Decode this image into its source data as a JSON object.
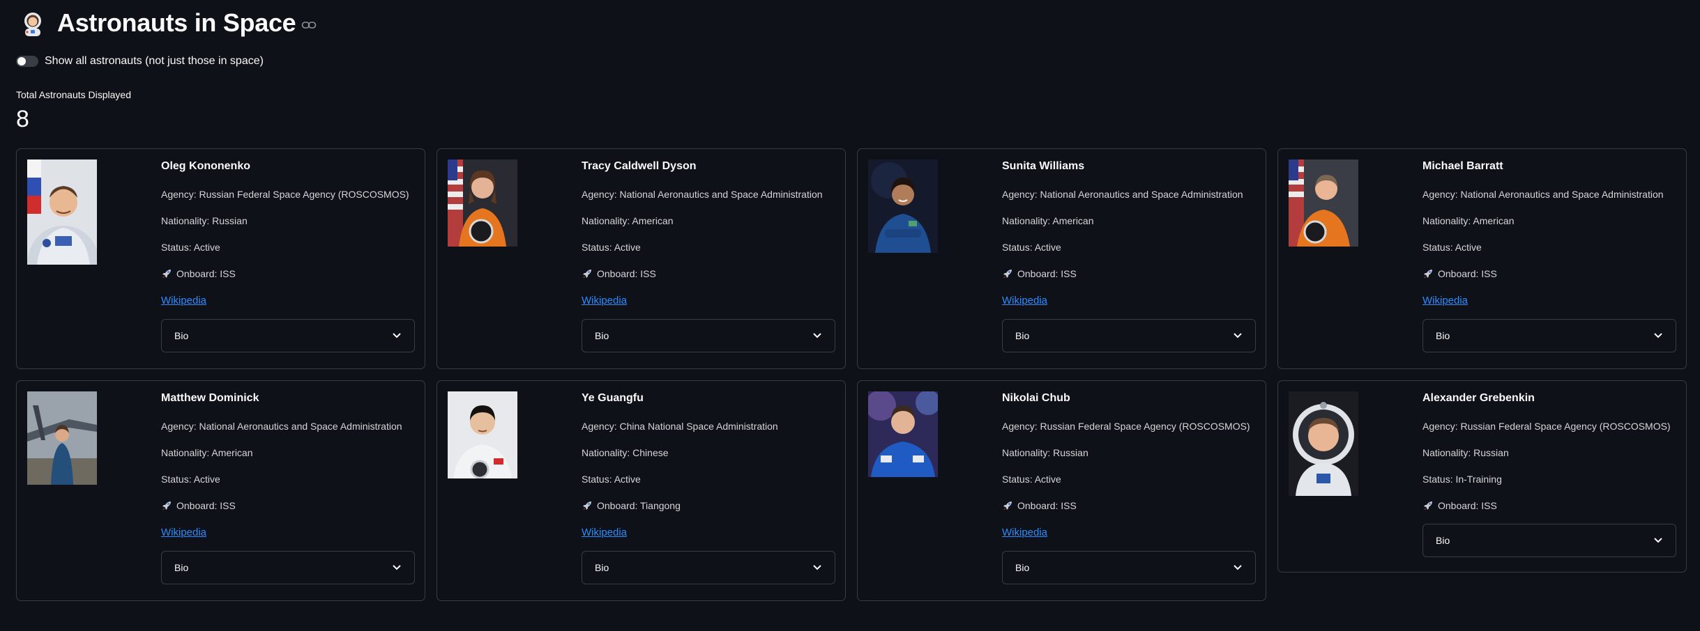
{
  "header": {
    "title": "Astronauts in Space"
  },
  "toggle": {
    "label": "Show all astronauts (not just those in space)",
    "on": false
  },
  "metric": {
    "label": "Total Astronauts Displayed",
    "value": "8"
  },
  "cards": [
    {
      "name": "Oleg Kononenko",
      "agency": "Agency: Russian Federal Space Agency (ROSCOSMOS)",
      "nationality": "Nationality: Russian",
      "status": "Status: Active",
      "onboard": "Onboard: ISS",
      "wiki": "Wikipedia",
      "bio": "Bio"
    },
    {
      "name": "Tracy Caldwell Dyson",
      "agency": "Agency: National Aeronautics and Space Administration",
      "nationality": "Nationality: American",
      "status": "Status: Active",
      "onboard": "Onboard: ISS",
      "wiki": "Wikipedia",
      "bio": "Bio"
    },
    {
      "name": "Sunita Williams",
      "agency": "Agency: National Aeronautics and Space Administration",
      "nationality": "Nationality: American",
      "status": "Status: Active",
      "onboard": "Onboard: ISS",
      "wiki": "Wikipedia",
      "bio": "Bio"
    },
    {
      "name": "Michael Barratt",
      "agency": "Agency: National Aeronautics and Space Administration",
      "nationality": "Nationality: American",
      "status": "Status: Active",
      "onboard": "Onboard: ISS",
      "wiki": "Wikipedia",
      "bio": "Bio"
    },
    {
      "name": "Matthew Dominick",
      "agency": "Agency: National Aeronautics and Space Administration",
      "nationality": "Nationality: American",
      "status": "Status: Active",
      "onboard": "Onboard: ISS",
      "wiki": "Wikipedia",
      "bio": "Bio"
    },
    {
      "name": "Ye Guangfu",
      "agency": "Agency: China National Space Administration",
      "nationality": "Nationality: Chinese",
      "status": "Status: Active",
      "onboard": "Onboard: Tiangong",
      "wiki": "Wikipedia",
      "bio": "Bio"
    },
    {
      "name": "Nikolai Chub",
      "agency": "Agency: Russian Federal Space Agency (ROSCOSMOS)",
      "nationality": "Nationality: Russian",
      "status": "Status: Active",
      "onboard": "Onboard: ISS",
      "wiki": "Wikipedia",
      "bio": "Bio"
    },
    {
      "name": "Alexander Grebenkin",
      "agency": "Agency: Russian Federal Space Agency (ROSCOSMOS)",
      "nationality": "Nationality: Russian",
      "status": "Status: In-Training",
      "onboard": "Onboard: ISS",
      "bio": "Bio"
    }
  ],
  "colors": {
    "background": "#0e1117",
    "border": "#3a3c44",
    "link": "#2d8cff",
    "text": "#fafafa"
  },
  "icons": [
    "astronaut-emoji-icon",
    "link-icon",
    "rocket-icon",
    "chevron-down-icon"
  ]
}
